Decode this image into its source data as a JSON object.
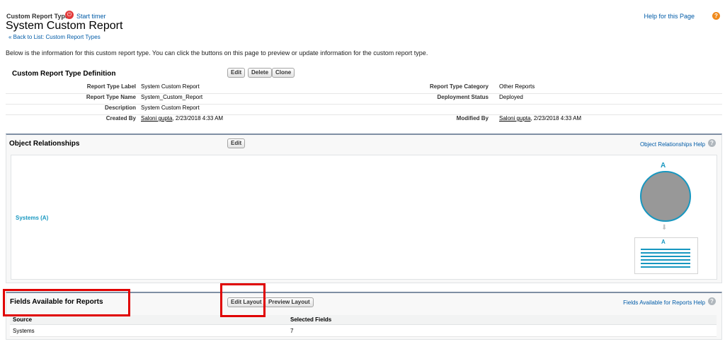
{
  "header": {
    "object_type": "Custom Report Type",
    "timer_link": "Start timer",
    "title": "System Custom Report",
    "back_link": "« Back to List: Custom Report Types",
    "help_link": "Help for this Page"
  },
  "intro": "Below is the information for this custom report type. You can click the buttons on this page to preview or update information for the custom report type.",
  "definition": {
    "title": "Custom Report Type Definition",
    "buttons": {
      "edit": "Edit",
      "delete": "Delete",
      "clone": "Clone"
    },
    "rows": [
      {
        "l_label": "Report Type Label",
        "l_value": "System Custom Report",
        "r_label": "Report Type Category",
        "r_value": "Other Reports"
      },
      {
        "l_label": "Report Type Name",
        "l_value": "System_Custom_Report",
        "r_label": "Deployment Status",
        "r_value": "Deployed"
      },
      {
        "l_label": "Description",
        "l_value": "System Custom Report",
        "r_label": "",
        "r_value": ""
      }
    ],
    "created_by": {
      "label": "Created By",
      "user": "Saloni gupta",
      "date": ", 2/23/2018 4:33 AM"
    },
    "modified_by": {
      "label": "Modified By",
      "user": "Saloni gupta",
      "date": ", 2/23/2018 4:33 AM"
    }
  },
  "relationships": {
    "title": "Object Relationships",
    "edit_button": "Edit",
    "help_link": "Object Relationships Help",
    "object_link": "Systems (A)",
    "diagram_letter": "A",
    "box_letter": "A"
  },
  "fields": {
    "title": "Fields Available for Reports",
    "edit_layout_button": "Edit Layout",
    "preview_layout_button": "Preview Layout",
    "help_link": "Fields Available for Reports Help",
    "columns": [
      "Source",
      "Selected Fields"
    ],
    "rows": [
      {
        "source": "Systems",
        "selected": "7"
      }
    ]
  },
  "icons": {
    "timer": "power-icon",
    "help": "question-icon",
    "arrow": "down-arrow-icon"
  },
  "colors": {
    "link": "#015ba7",
    "accent": "#1797c0",
    "highlight": "#e00000"
  }
}
